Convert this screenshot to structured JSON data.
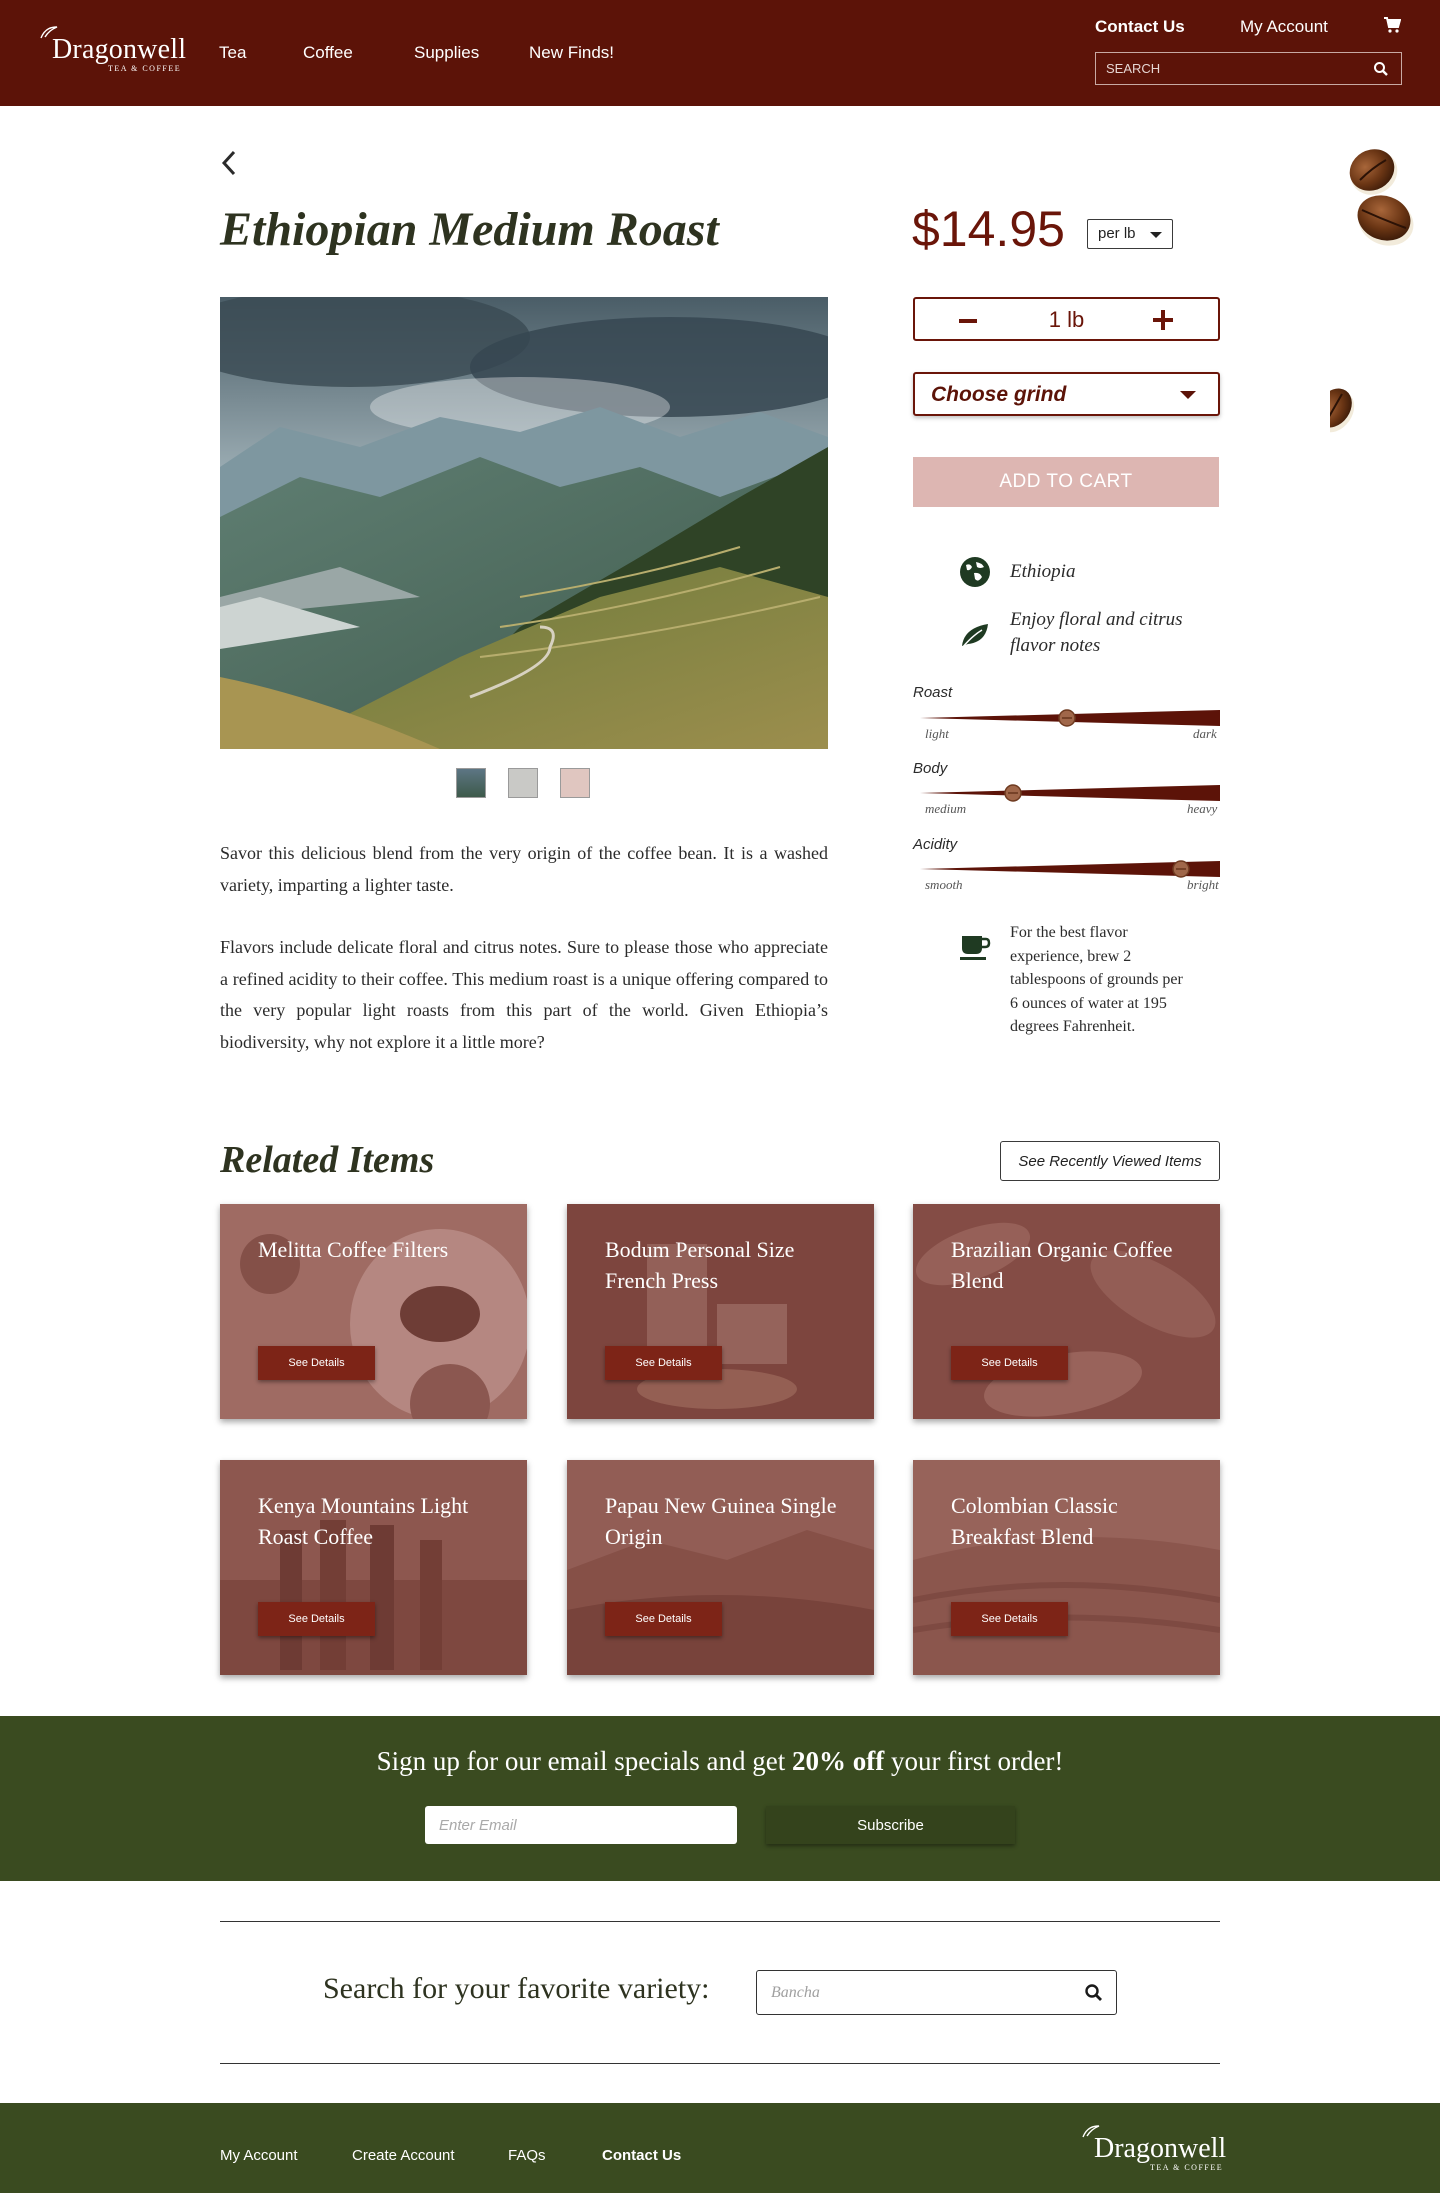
{
  "brand": {
    "name": "Dragonwell",
    "tagline": "TEA & COFFEE"
  },
  "header": {
    "nav": [
      "Tea",
      "Coffee",
      "Supplies",
      "New Finds!"
    ],
    "contact": "Contact Us",
    "account": "My Account",
    "search_placeholder": "SEARCH"
  },
  "product": {
    "title": "Ethiopian Medium Roast",
    "price": "$14.95",
    "unit": "per lb",
    "quantity": "1 lb",
    "grind_placeholder": "Choose grind",
    "add_to_cart": "ADD TO CART",
    "origin": "Ethiopia",
    "flavor_line1": "Enjoy floral and citrus",
    "flavor_line2": "flavor notes",
    "description_p1": "Savor this delicious blend from the very origin of the coffee bean.  It is a washed variety, imparting a lighter taste.",
    "description_p2": "Flavors include delicate floral and citrus notes.  Sure to please those who appreciate a refined acidity to their coffee.  This medium roast is a unique offering compared to the very popular light roasts from this part of the world. Given Ethiopia’s biodiversity, why not explore it a little more?",
    "scales": [
      {
        "label": "Roast",
        "low": "light",
        "high": "dark",
        "level": 0.49
      },
      {
        "label": "Body",
        "low": "medium",
        "high": "heavy",
        "level": 0.31
      },
      {
        "label": "Acidity",
        "low": "smooth",
        "high": "bright",
        "level": 0.87
      }
    ],
    "brew_tip": "For the best flavor experience, brew 2 tablespoons of grounds per 6 ounces of water at 195 degrees Fahrenheit."
  },
  "related": {
    "title": "Related Items",
    "recent_button": "See Recently Viewed Items",
    "details_label": "See Details",
    "items": [
      "Melitta Coffee Filters",
      "Bodum Personal Size French Press",
      "Brazilian Organic Coffee Blend",
      "Kenya Mountains Light Roast Coffee",
      "Papau New Guinea Single Origin",
      "Colombian Classic Breakfast Blend"
    ]
  },
  "newsletter": {
    "text_before": "Sign up for our email specials and get ",
    "text_bold": "20% off",
    "text_after": " your first order!",
    "email_placeholder": "Enter Email",
    "subscribe": "Subscribe"
  },
  "variety_search": {
    "label": "Search for your favorite variety:",
    "placeholder": "Bancha"
  },
  "footer": {
    "links": [
      "My Account",
      "Create Account",
      "FAQs",
      "Contact Us"
    ]
  },
  "colors": {
    "maroon": "#5c1308",
    "green": "#3a4b20",
    "cart_disabled": "#ddb6b2"
  }
}
